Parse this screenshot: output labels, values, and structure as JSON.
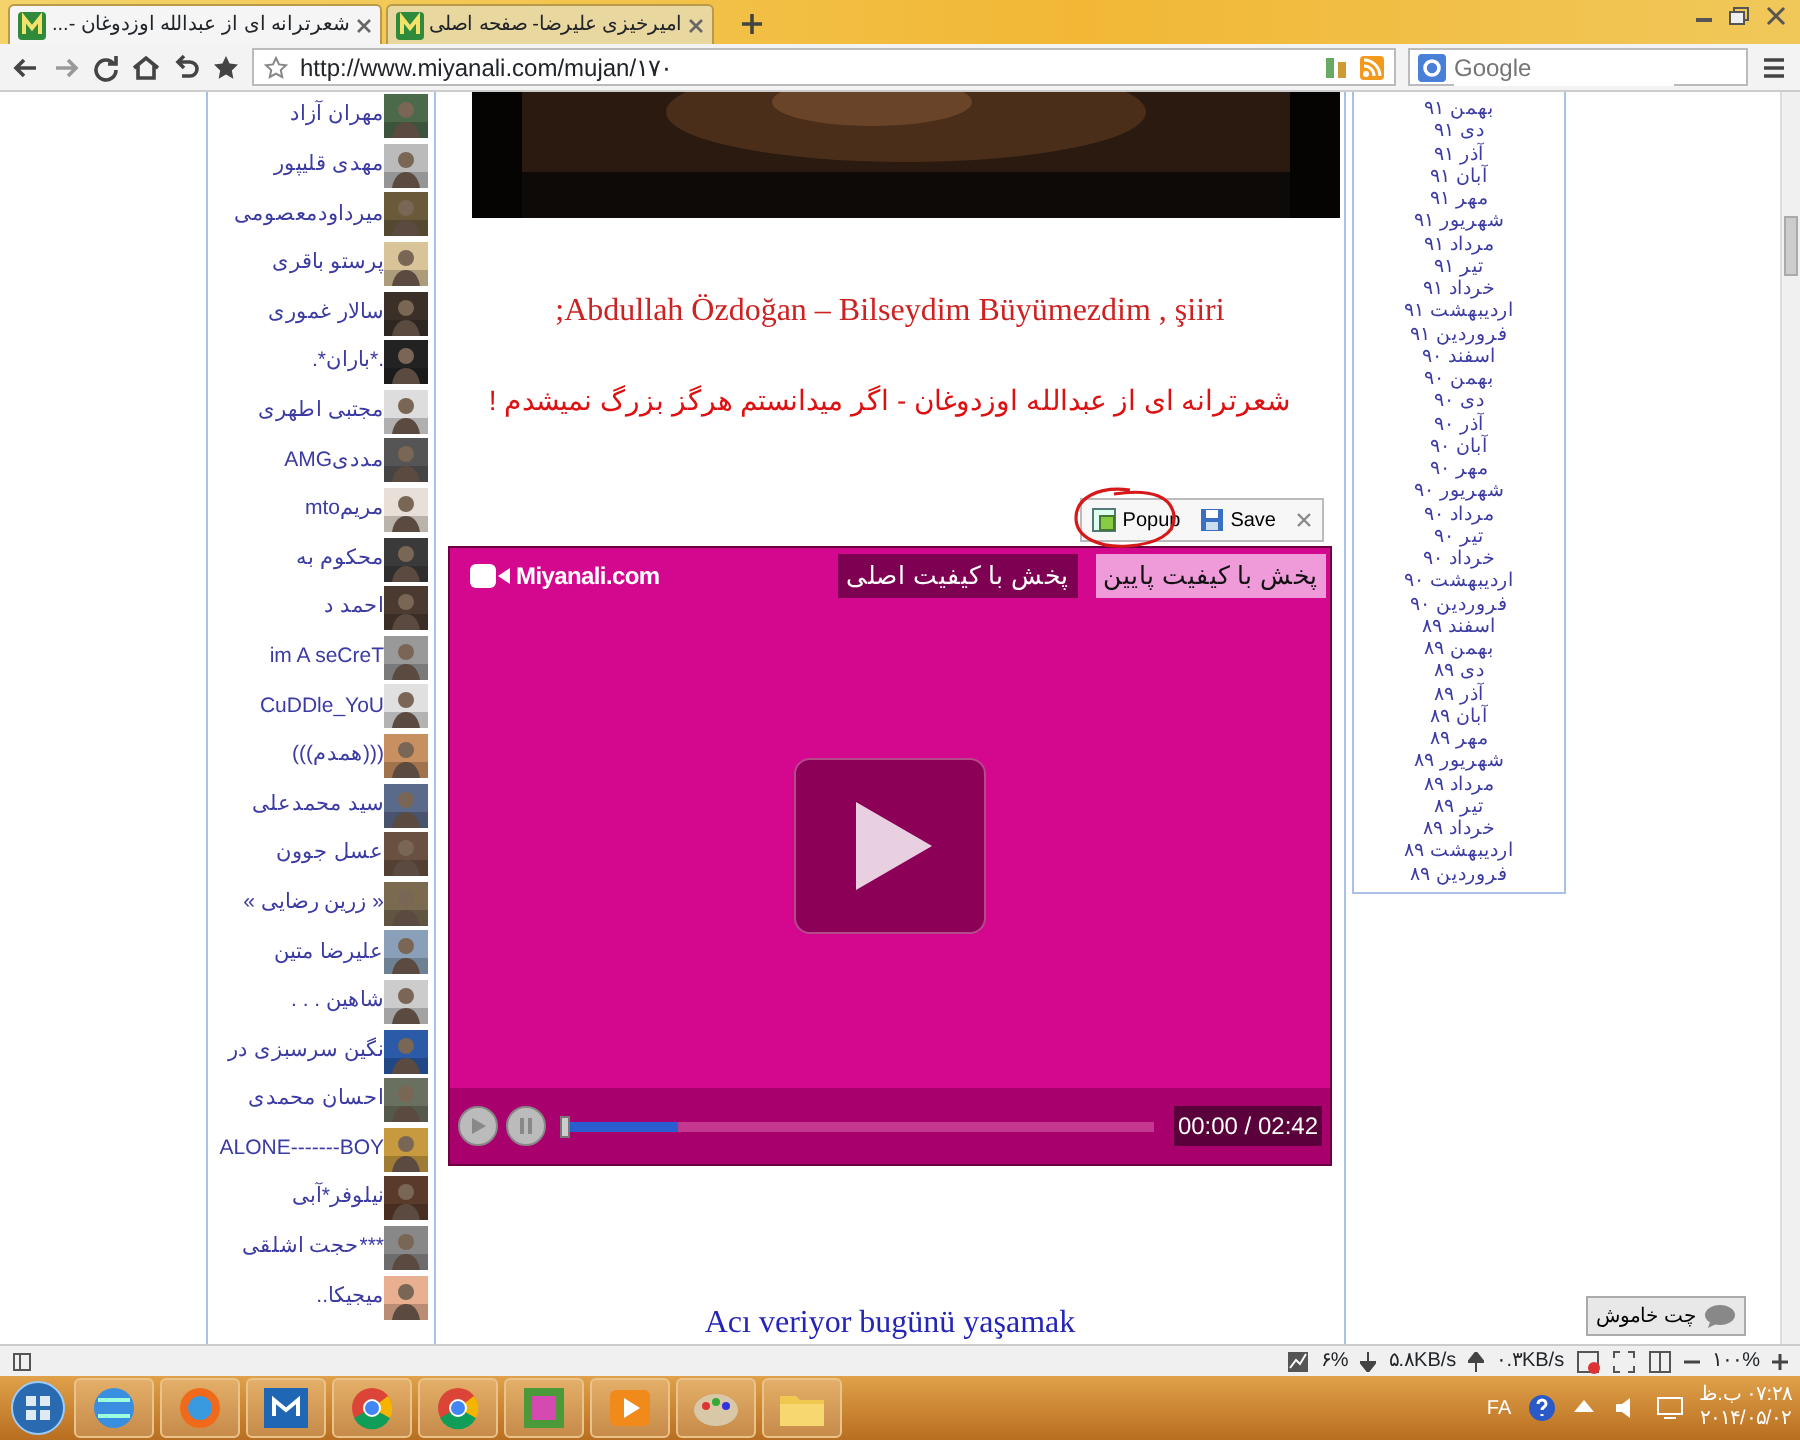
{
  "browser": {
    "tabs": [
      {
        "title": "امیرخیزی علیرضا- صفحه اصلی",
        "selected": false
      },
      {
        "title": "شعرترانه ای از عبدالله اوزدوغان -...",
        "selected": true
      }
    ],
    "address": "http://www.miyanali.com/mujan/۱۷۰",
    "search": {
      "placeholder": "Google"
    }
  },
  "sidebar_users": [
    {
      "name": "مهران آزاد"
    },
    {
      "name": "مهدی قلیپور"
    },
    {
      "name": "میرداودمعصومی"
    },
    {
      "name": "پرستو باقری"
    },
    {
      "name": "سالار غموری"
    },
    {
      "name": ".*باران*."
    },
    {
      "name": "مجتبی اطهری"
    },
    {
      "name": "مددیAMG"
    },
    {
      "name": "مریمmto"
    },
    {
      "name": "محکوم به"
    },
    {
      "name": "احمد د"
    },
    {
      "name": "im A seCreT"
    },
    {
      "name": "CuDDle_YoU"
    },
    {
      "name": "(((همدم)))"
    },
    {
      "name": "سید محمدعلی"
    },
    {
      "name": "عسل جوون"
    },
    {
      "name": "« زرین رضایی »"
    },
    {
      "name": "علیرضا متین"
    },
    {
      "name": "شاهین . . ."
    },
    {
      "name": "نگین سرسبزی در"
    },
    {
      "name": "احسان محمدی"
    },
    {
      "name": "ALONE-------BOY"
    },
    {
      "name": "نیلوفر*آبی"
    },
    {
      "name": "***حجت اشلقی"
    },
    {
      "name": "میجیکا.."
    }
  ],
  "article": {
    "title_latin": ";Abdullah Özdoğan – Bilseydim Büyümezdim , şiiri",
    "title_persian": "شعرترانه ای از عبدالله اوزدوغان - اگر میدانستم هرگز بزرگ نمیشدم !",
    "toolbar": [
      {
        "kind": "close"
      },
      {
        "kind": "save",
        "label": "Save"
      },
      {
        "kind": "popup",
        "label": "Popup"
      }
    ],
    "next_title": "Acı veriyor bugünü yaşamak"
  },
  "player": {
    "logo": "Miyanali.com",
    "quality_buttons": [
      {
        "label": "پخش با کیفیت پایین",
        "selected": false
      },
      {
        "label": "پخش با کیفیت اصلی",
        "selected": true
      }
    ],
    "progress": {
      "level": 0.19
    },
    "time": "00:00 / 02:42"
  },
  "archive": [
    "بهمن ۹۱",
    "دی ۹۱",
    "آذر ۹۱",
    "آبان ۹۱",
    "مهر ۹۱",
    "شهریور ۹۱",
    "مرداد ۹۱",
    "تیر ۹۱",
    "خرداد ۹۱",
    "اردیبهشت ۹۱",
    "فروردین ۹۱",
    "اسفند ۹۰",
    "بهمن ۹۰",
    "دی ۹۰",
    "آذر ۹۰",
    "آبان ۹۰",
    "مهر ۹۰",
    "شهریور ۹۰",
    "مرداد ۹۰",
    "تیر ۹۰",
    "خرداد ۹۰",
    "اردیبهشت ۹۰",
    "فروردین ۹۰",
    "اسفند ۸۹",
    "بهمن ۸۹",
    "دی ۸۹",
    "آذر ۸۹",
    "آبان ۸۹",
    "مهر ۸۹",
    "شهریور ۸۹",
    "مرداد ۸۹",
    "تیر ۸۹",
    "خرداد ۸۹",
    "اردیبهشت ۸۹",
    "فروردین ۸۹"
  ],
  "chat_button": "چت خاموش",
  "status_bar": {
    "cpu": "۶%",
    "download": "۵.۸KB/s",
    "upload": "۰.۳KB/s",
    "zoom": "۱۰۰%"
  },
  "taskbar": {
    "language": "FA",
    "time": "۰۷:۲۸ ب.ظ",
    "date": "۲۰۱۴/۰۵/۰۲"
  }
}
